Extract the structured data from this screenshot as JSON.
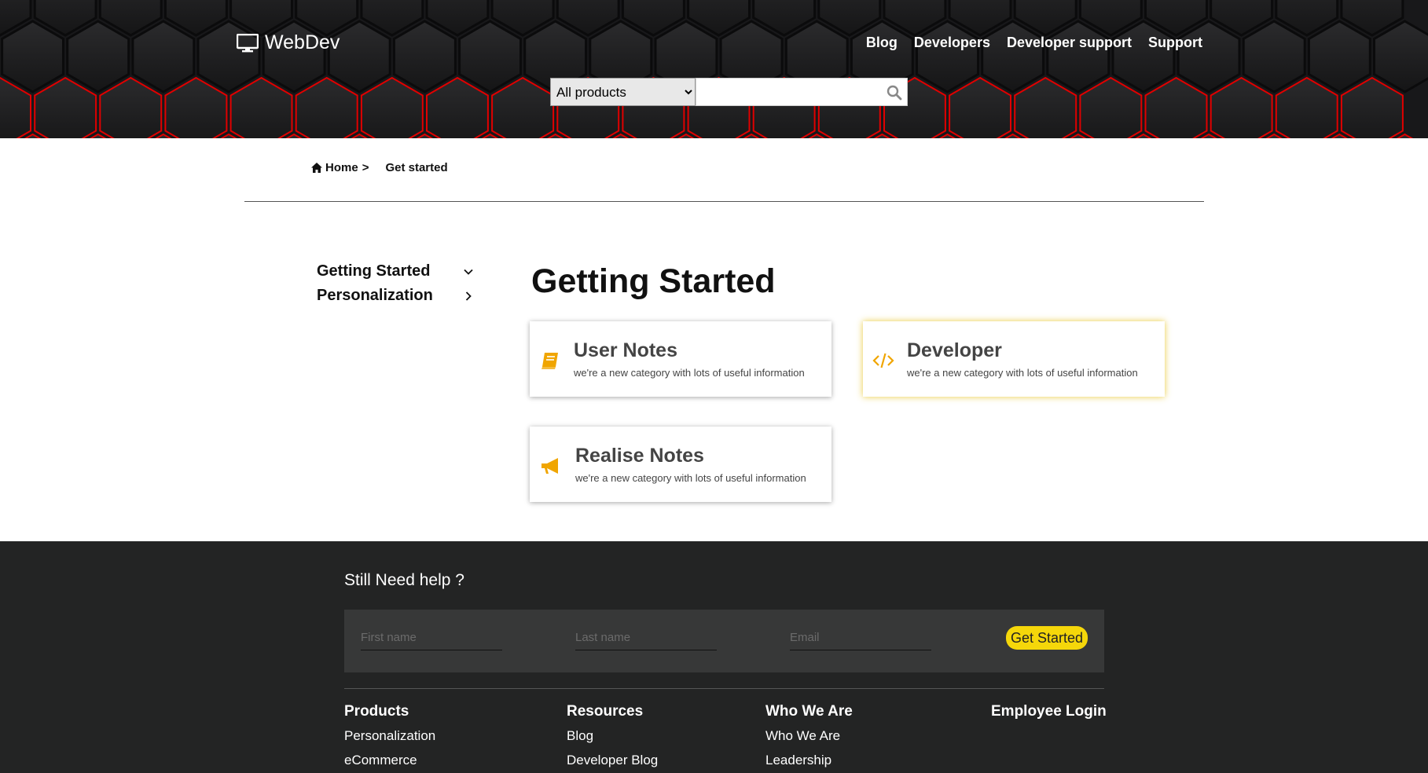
{
  "header": {
    "logo_text": "WebDev",
    "nav": [
      "Blog",
      "Developers",
      "Developer support",
      "Support"
    ],
    "search": {
      "category_selected": "All products",
      "placeholder": ""
    }
  },
  "breadcrumb": {
    "home": "Home",
    "separator": ">",
    "current": "Get started"
  },
  "sidebar": {
    "items": [
      {
        "label": "Getting Started",
        "icon": "chevron-down-icon"
      },
      {
        "label": "Personalization",
        "icon": "chevron-right-icon"
      }
    ]
  },
  "main": {
    "title": "Getting Started",
    "cards": [
      {
        "title": "User Notes",
        "desc": "we're a new category with lots of useful information",
        "icon": "book-icon"
      },
      {
        "title": "Developer",
        "desc": "we're a new category with lots of useful information",
        "icon": "code-icon"
      },
      {
        "title": "Realise Notes",
        "desc": "we're a new category with lots of useful information",
        "icon": "megaphone-icon"
      }
    ]
  },
  "footer": {
    "help_title": "Still Need help ?",
    "form": {
      "first_name_placeholder": "First name",
      "last_name_placeholder": "Last name",
      "email_placeholder": "Email",
      "submit_label": "Get Started"
    },
    "columns": [
      {
        "heading": "Products",
        "links": [
          "Personalization",
          "eCommerce"
        ]
      },
      {
        "heading": "Resources",
        "links": [
          "Blog",
          "Developer Blog"
        ]
      },
      {
        "heading": "Who We Are",
        "links": [
          "Who We Are",
          "Leadership"
        ]
      },
      {
        "heading": "Employee Login",
        "links": []
      }
    ]
  },
  "colors": {
    "accent_yellow": "#f5d70a",
    "icon_orange": "#f0a500",
    "header_glow": "#e00000",
    "footer_bg": "#232424"
  }
}
